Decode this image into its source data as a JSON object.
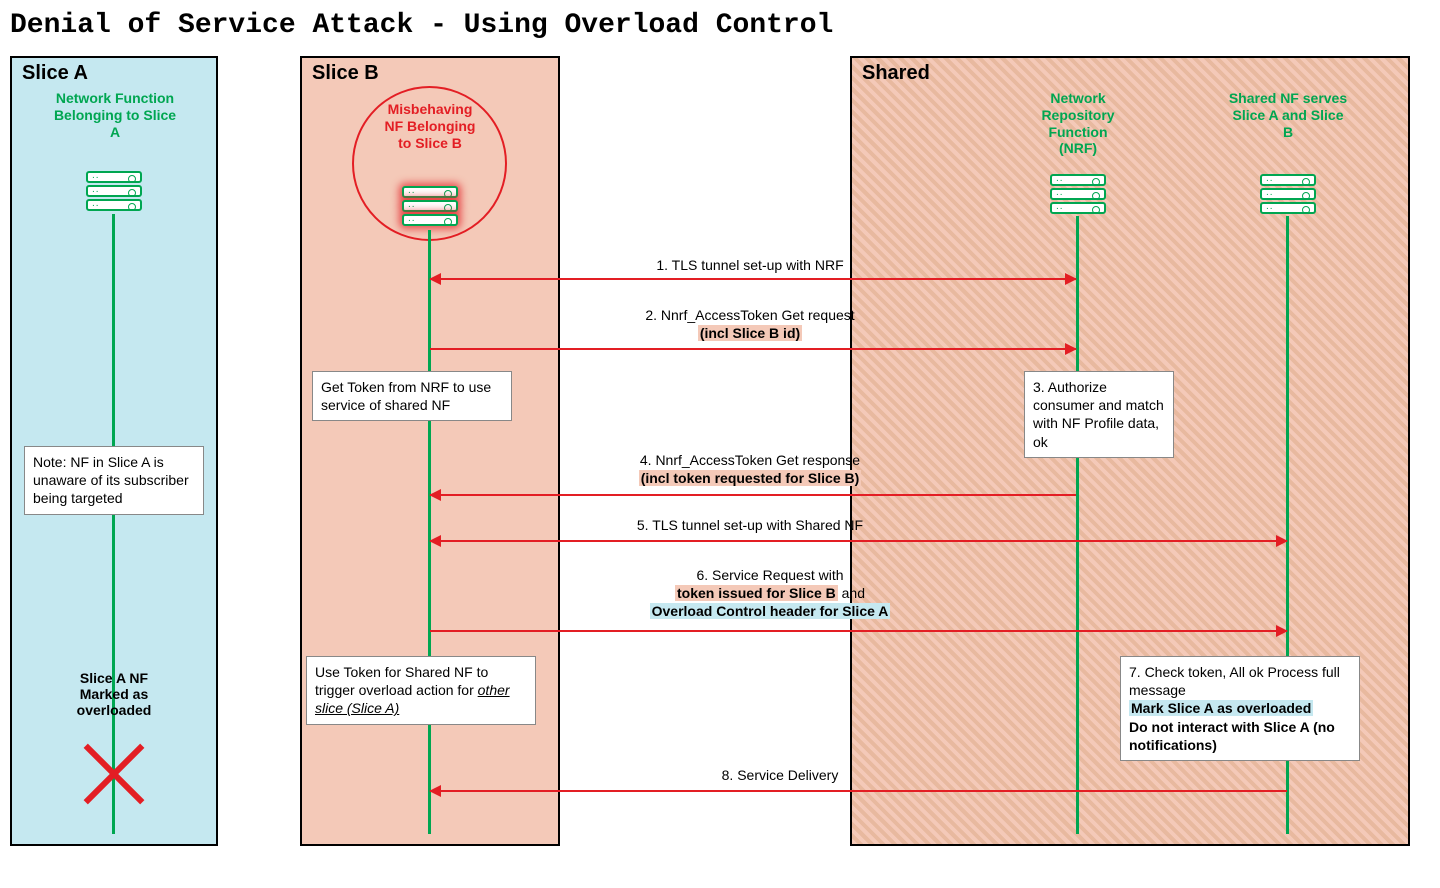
{
  "title": "Denial of Service Attack - Using Overload Control",
  "regions": {
    "sliceA": "Slice A",
    "sliceB": "Slice B",
    "shared": "Shared"
  },
  "labels": {
    "nfA": "Network Function Belonging to Slice A",
    "badNf": "Misbehaving NF Belonging to Slice B",
    "nrf": "Network Repository Function (NRF)",
    "sharedNf": "Shared NF serves Slice A and Slice B"
  },
  "notes": {
    "sliceA": "Note: NF in Slice A is unaware of its subscriber being targeted",
    "sliceA_status": "Slice A NF Marked as overloaded",
    "getToken": "Get Token from NRF to use service of shared NF",
    "useToken_pre": "Use Token for Shared NF to trigger overload action for ",
    "useToken_em": "other slice (Slice A)",
    "nrfAuth": "3. Authorize consumer and match with NF Profile data, ok",
    "sharedCheck_l1": "7. Check token, All ok Process full message",
    "sharedCheck_l2": "Mark Slice A as overloaded",
    "sharedCheck_l3": "Do not interact with Slice A (no notifications)"
  },
  "messages": {
    "m1": "1. TLS tunnel set-up with NRF",
    "m2": "2. Nnrf_AccessToken  Get request",
    "m2_hl": "(incl Slice B id)",
    "m4": "4. Nnrf_AccessToken  Get response",
    "m4_hl": "(incl token requested for Slice B)",
    "m5": "5. TLS tunnel set-up with Shared NF",
    "m6": "6. Service Request with",
    "m6_hl1": "token issued for Slice B",
    "m6_and": " and ",
    "m6_hl2": "Overload Control header for Slice A",
    "m8": "8. Service Delivery"
  }
}
